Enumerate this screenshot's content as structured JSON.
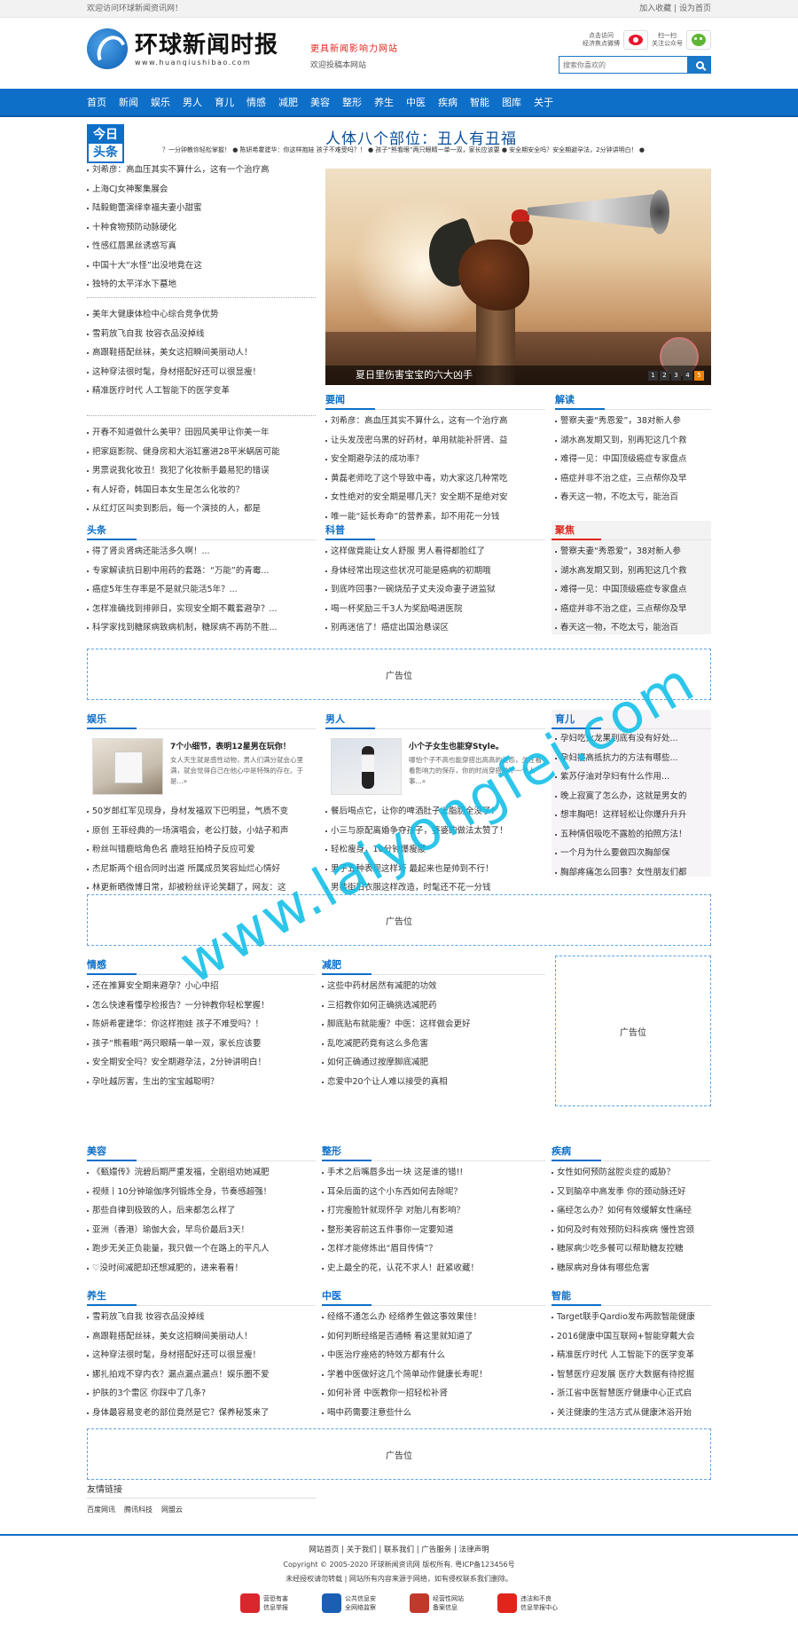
{
  "topbar": {
    "welcome": "欢迎访问环球新闻资讯网！",
    "fav": "加入收藏",
    "sep": "|",
    "home": "设为首页"
  },
  "header": {
    "logo_cn": "环球新闻时报",
    "logo_en": "www.huanqiushibao.com",
    "slogan": "更具新闻影响力网站",
    "contribute": "欢迎投稿本网站",
    "weibo_label": [
      "点击访问",
      "经济焦点微博"
    ],
    "wechat_label": [
      "扫一扫",
      "关注公众号"
    ],
    "search_placeholder": "搜索你喜欢的"
  },
  "nav": [
    "首页",
    "新闻",
    "娱乐",
    "男人",
    "育儿",
    "情感",
    "减肥",
    "美容",
    "整形",
    "养生",
    "中医",
    "疾病",
    "智能",
    "图库",
    "关于"
  ],
  "today": {
    "badge_top": "今日",
    "badge_bottom": "头条",
    "headline": "人体八个部位：丑人有丑福",
    "ticker": "？一分钟教你轻松掌握！ ● 陈妍希霍建华：你这样抱娃 孩子不难受吗？！ ● 孩子“熊看眼”两只眼睛一单一双，家长应该要 ● 安全期安全吗？安全期避孕法，2分钟讲明白！ ●"
  },
  "left_list_1": [
    "刘希彦：高血压其实不算什么，这有一个治疗高",
    "上海CJ女神聚集展会",
    "陆毅鲍蕾演绎幸福夫妻小甜蜜",
    "十种食物预防动脉硬化",
    "性感红唇黑丝诱惑写真",
    "中国十大“水怪”出没地竟在这",
    "独特的太平洋水下墓地"
  ],
  "left_list_2": [
    "美年大健康体检中心综合竞争优势",
    "雪莉放飞自我 妆容衣品没掉线",
    "高跟鞋搭配丝袜，美女这招瞬间美丽动人！",
    "这种穿法很时髦，身材搭配好还可以很显瘦！",
    "精准医疗时代 人工智能下的医学变革"
  ],
  "left_list_3": [
    "开春不知道做什么美甲？田园风美甲让你美一年",
    "把家庭影院、健身房和大浴缸塞进28平米蜗居可能",
    "男票说我化妆丑！我犯了化妆新手最易犯的错误",
    "有人好奇，韩国日本女生是怎么化妆的？",
    "从红灯区叫卖到影后，每一个演技的人，都是"
  ],
  "slider": {
    "caption": "夏日里伤害宝宝的六大凶手",
    "pages": [
      "1",
      "2",
      "3",
      "4",
      "5"
    ]
  },
  "yaowen": {
    "title": "要闻",
    "items": [
      "刘希彦：高血压其实不算什么，这有一个治疗高",
      "让头发茂密乌黑的好药材，单用就能补肝肾、益",
      "安全期避孕法的成功率？",
      "黄磊老师吃了这个导致中毒，劝大家这几种常吃",
      "女性绝对的安全期是哪几天？安全期不是绝对安",
      "唯一能“延长寿命”的营养素，却不用花一分钱"
    ]
  },
  "jiedu": {
    "title": "解读",
    "items": [
      "警察夫妻“秀恩爱”，38对新人参",
      "湖水高发期又到，别再犯这几个救",
      "难得一见：中国顶级癌症专家盘点",
      "癌症并非不治之症，三点帮你及早",
      "春天这一物，不吃太亏，能治百"
    ]
  },
  "toutiao": {
    "title": "头条",
    "items": [
      "得了肾炎肾病还能活多久啊！...",
      "专家解读抗日剧中用药的套路：“万能”的青霉...",
      "癌症5年生存率是不是就只能活5年？...",
      "怎样准确找到排卵日，实现安全期不戴套避孕？...",
      "科学家找到糖尿病致病机制，糖尿病不再防不胜..."
    ]
  },
  "keji": {
    "title": "科普",
    "items": [
      "这样做竟能让女人舒服 男人看得都脸红了",
      "身体经常出现这些状况可能是癌病的初期哦",
      "到底咋回事?一碗烧茄子丈夫没命妻子进监狱",
      "喝一杯奖励三千3人为奖励喝进医院",
      "别再迷信了！癌症出国治悬误区"
    ]
  },
  "jujiao": {
    "title": "聚焦",
    "items": [
      "警察夫妻“秀恩爱”，38对新人参",
      "湖水高发期又到，别再犯这几个救",
      "难得一见：中国顶级癌症专家盘点",
      "癌症并非不治之症，三点帮你及早",
      "春天这一物，不吃太亏，能治百"
    ]
  },
  "ad_label": "广告位",
  "yule": {
    "title": "娱乐",
    "feat_title": "7个小细节，表明12星男在玩你！",
    "feat_desc": "女人天生就是感性动物，男人们满分就会心里满，就会觉得自己在他心中是特殊的存在。于是...»",
    "items": [
      "50岁郎红军见现身，身材发福双下巴明显，气质不变",
      "原创 王菲经典的一场演唱会，老公打鼓，小姑子和声",
      "粉丝叫错鹿晗角色名 鹿晗狂拍椅子反应可爱",
      "杰尼斯两个组合同时出道 所属成员笑容灿烂心情好",
      "林更新晒微博日常，却被粉丝评论笑翻了，网友：这"
    ]
  },
  "nanren": {
    "title": "男人",
    "feat_title": "小个子女生也能穿Style。",
    "feat_desc": "哪怕个子不高也能穿搭出高高的姿态，关注看看影响力的保存，你的时尚穿搭并不一个人事...»",
    "items": [
      "餐后喝点它，让你的啤酒肚子上脂肪全没了！",
      "小三与原配离婚争夺孩子，婆婆的做法太赞了！",
      "轻松瘦身，10分钟爆瘦腰",
      "男子五种表现这样坏 最起来也是帅到不行！",
      "男装街旧衣服这样改造，时髦还不花一分钱"
    ]
  },
  "yuer": {
    "title": "育儿",
    "items": [
      "孕妇吃火龙果到底有没有好处...",
      "孕妇提高抵抗力的方法有哪些...",
      "紫苏仔油对孕妇有什么作用...",
      "晚上寂寞了怎么办，这就是男女的",
      "想丰胸吧！这样轻松让你爆升升升",
      "五种情侣吸吃不露脸的拍照方法！",
      "一个月为什么要做四次胸部保",
      "胸部疼痛怎么回事？女性朋友们都"
    ]
  },
  "qinggan": {
    "title": "情感",
    "items": [
      "还在推算安全期来避孕？小心中招",
      "怎么快速看懂孕检报告？一分钟教你轻松掌握！",
      "陈妍希霍建华：你这样抱娃 孩子不难受吗？！",
      "孩子“熊看眼”两只眼睛一单一双，家长应该要",
      "安全期安全吗？安全期避孕法，2分钟讲明白！",
      "孕吐越厉害，生出的宝宝越聪明？"
    ]
  },
  "jianfei": {
    "title": "减肥",
    "items": [
      "这些中药材居然有减肥的功效",
      "三招教你如何正确挑选减肥药",
      "脚底贴布就能瘦？中医：这样做会更好",
      "乱吃减肥药竟有这么多危害",
      "如何正确通过按摩脚底减肥",
      "恋爱中20个让人难以接受的真相"
    ]
  },
  "meirong": {
    "title": "美容",
    "items": [
      "《甄嬛传》浣碧后期严重发福，全剧组劝她减肥",
      "视频丨10分钟瑜伽序列锻炼全身，节奏感超强！",
      "那些自律到极致的人，后来都怎么样了",
      "亚洲（香港）瑜伽大会，早鸟价最后3天！",
      "跑步无关正负能量，我只做一个在路上的平凡人",
      "♡没时间减肥却还想减肥的，进来看看！"
    ]
  },
  "zhengxing": {
    "title": "整形",
    "items": [
      "手术之后嘴唇多出一块 这是谁的错!!",
      "耳朵后面的这个小东西如何去除呢？",
      "打完瘦脸针就现怀孕 对胎儿有影响？",
      "整形美容前这五件事你一定要知道",
      "怎样才能修炼出“眉目传情”？",
      "史上最全的花，认花不求人！赶紧收藏！"
    ]
  },
  "jibing": {
    "title": "疾病",
    "items": [
      "女性如何预防盆腔炎症的威胁？",
      "又到脑卒中高发季 你的颈动脉还好",
      "痛经怎么办？如何有效缓解女性痛经",
      "如何及时有效预防妇科疾病 慢性宫颈",
      "糖尿病少吃多餐可以帮助糖友控糖",
      "糖尿病对身体有哪些危害"
    ]
  },
  "yangsheng": {
    "title": "养生",
    "items": [
      "雪莉放飞自我 妆容衣品没掉线",
      "高跟鞋搭配丝袜，美女这招瞬间美丽动人！",
      "这种穿法很时髦，身材搭配好还可以很显瘦！",
      "娜扎拍戏不穿内衣？漏点漏点漏点！娱乐圈不爱",
      "护肤的3个雷区 你踩中了几条?",
      "身体最容易变老的部位竟然是它？保养秘笈来了"
    ]
  },
  "zhongyi": {
    "title": "中医",
    "items": [
      "经络不通怎么办 经络养生做这事效果佳！",
      "如何判断经络是否通畅 看这里就知道了",
      "中医治疗痤疮的特效方都有什么",
      "学着中医做好这几个简单动作健康长寿呢！",
      "如何补肾 中医教你一招轻松补肾",
      "喝中药需要注意些什么"
    ]
  },
  "zhineng": {
    "title": "智能",
    "items": [
      "Target联手Qardio发布两款智能健康",
      "2016健康中国互联网+智能穿戴大会",
      "精准医疗时代 人工智能下的医学变革",
      "智慧医疗迎发展 医疗大数据有待挖掘",
      "浙江省中医智慧医疗健康中心正式启",
      "关注健康的生活方式从健康沐浴开始"
    ]
  },
  "friendlinks": {
    "title": "友情链接",
    "items": [
      "百度网讯",
      "腾讯科技",
      "网盟云"
    ]
  },
  "footer": {
    "links": [
      "网站首页",
      "关于我们",
      "联系我们",
      "广告服务",
      "法律声明"
    ],
    "copyright": "Copyright © 2005-2020 环球新闻资讯网 版权所有. 粤ICP备123456号",
    "notice": "未经授权请勿转载 | 网站所有内容来源于网络，如有侵权联系我们删除。",
    "badges": [
      {
        "l1": "营恐有害",
        "l2": "信息举报",
        "color": "#d9272e"
      },
      {
        "l1": "公共信息安",
        "l2": "全网络监察",
        "color": "#1a5fb4"
      },
      {
        "l1": "经营性网站",
        "l2": "备案信息",
        "color": "#c0392b"
      },
      {
        "l1": "违法和不良",
        "l2": "信息举报中心",
        "color": "#e1251b"
      }
    ]
  },
  "watermark": "www.laiyongfei.com"
}
